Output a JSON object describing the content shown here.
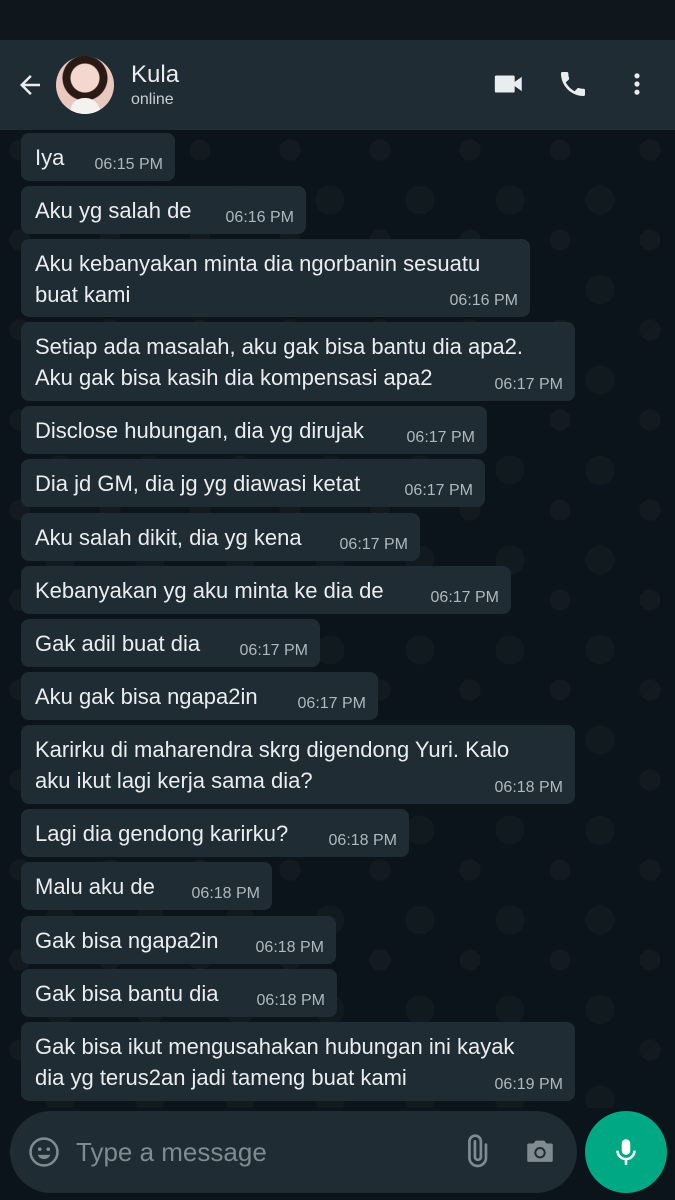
{
  "header": {
    "contact_name": "Kula",
    "status": "online"
  },
  "messages": [
    {
      "text": "Iya",
      "time": "06:15 PM"
    },
    {
      "text": "Aku yg salah de",
      "time": "06:16 PM"
    },
    {
      "text": "Aku kebanyakan minta dia ngorbanin sesuatu\nbuat kami",
      "time": "06:16 PM"
    },
    {
      "text": "Setiap ada masalah, aku gak bisa bantu dia apa2.\nAku gak bisa kasih dia kompensasi apa2",
      "time": "06:17 PM"
    },
    {
      "text": "Disclose hubungan, dia yg dirujak",
      "time": "06:17 PM"
    },
    {
      "text": "Dia jd GM, dia jg yg diawasi ketat",
      "time": "06:17 PM"
    },
    {
      "text": "Aku salah dikit, dia yg kena",
      "time": "06:17 PM"
    },
    {
      "text": "Kebanyakan yg aku minta ke dia de",
      "time": "06:17 PM"
    },
    {
      "text": "Gak adil buat dia",
      "time": "06:17 PM"
    },
    {
      "text": "Aku gak bisa ngapa2in",
      "time": "06:17 PM"
    },
    {
      "text": "Karirku di maharendra skrg digendong Yuri. Kalo\naku ikut lagi kerja sama dia?",
      "time": "06:18 PM"
    },
    {
      "text": "Lagi dia gendong karirku?",
      "time": "06:18 PM"
    },
    {
      "text": "Malu aku de",
      "time": "06:18 PM"
    },
    {
      "text": "Gak bisa ngapa2in",
      "time": "06:18 PM"
    },
    {
      "text": "Gak bisa bantu dia",
      "time": "06:18 PM"
    },
    {
      "text": "Gak bisa ikut mengusahakan hubungan ini kayak\ndia yg terus2an jadi tameng buat kami",
      "time": "06:19 PM"
    }
  ],
  "composer": {
    "placeholder": "Type a message"
  },
  "icons": {
    "back": "arrow-left-icon",
    "video": "video-call-icon",
    "call": "phone-icon",
    "menu": "more-vert-icon",
    "emoji": "emoji-icon",
    "attach": "paperclip-icon",
    "camera": "camera-icon",
    "mic": "microphone-icon"
  },
  "colors": {
    "header_bg": "#1f2c33",
    "chat_bg": "#0b141a",
    "bubble_bg": "#202c33",
    "accent": "#00a884"
  }
}
